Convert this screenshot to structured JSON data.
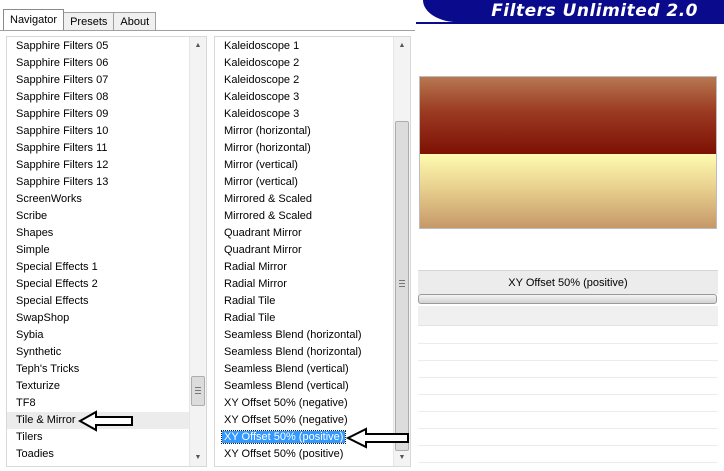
{
  "tabs": [
    {
      "label": "Navigator",
      "active": true
    },
    {
      "label": "Presets",
      "active": false
    },
    {
      "label": "About",
      "active": false
    }
  ],
  "banner": {
    "title": "Filters Unlimited 2.0",
    "color": "#0a0a8c"
  },
  "categories": {
    "items": [
      "Sapphire Filters 05",
      "Sapphire Filters 06",
      "Sapphire Filters 07",
      "Sapphire Filters 08",
      "Sapphire Filters 09",
      "Sapphire Filters 10",
      "Sapphire Filters 11",
      "Sapphire Filters 12",
      "Sapphire Filters 13",
      "ScreenWorks",
      "Scribe",
      "Shapes",
      "Simple",
      "Special Effects 1",
      "Special Effects 2",
      "Special Effects",
      "SwapShop",
      "Sybia",
      "Synthetic",
      "Teph's Tricks",
      "Texturize",
      "TF8",
      "Tile & Mirror",
      "Tilers",
      "Toadies"
    ],
    "selected": "Tile & Mirror",
    "scroll_fraction": 0.9
  },
  "filters": {
    "items": [
      "Kaleidoscope 1",
      "Kaleidoscope 2",
      "Kaleidoscope 2",
      "Kaleidoscope 3",
      "Kaleidoscope 3",
      "Mirror (horizontal)",
      "Mirror (horizontal)",
      "Mirror (vertical)",
      "Mirror (vertical)",
      "Mirrored & Scaled",
      "Mirrored & Scaled",
      "Quadrant Mirror",
      "Quadrant Mirror",
      "Radial Mirror",
      "Radial Mirror",
      "Radial Tile",
      "Radial Tile",
      "Seamless Blend (horizontal)",
      "Seamless Blend (horizontal)",
      "Seamless Blend (vertical)",
      "Seamless Blend (vertical)",
      "XY Offset 50% (negative)",
      "XY Offset 50% (negative)",
      "XY Offset 50% (positive)",
      "XY Offset 50% (positive)"
    ],
    "selected_index": 23,
    "scroll_fraction": 1.0,
    "selection_color": "#3399ff"
  },
  "preview": {
    "top_colors": [
      "#b77750",
      "#7d1104"
    ],
    "bottom_colors": [
      "#fffbb0",
      "#c49566"
    ]
  },
  "filter_name": "XY Offset 50% (positive)",
  "icons": {
    "scroll_up": "chevron-up-icon",
    "scroll_down": "chevron-down-icon",
    "pointer": "arrow-left-icon"
  }
}
